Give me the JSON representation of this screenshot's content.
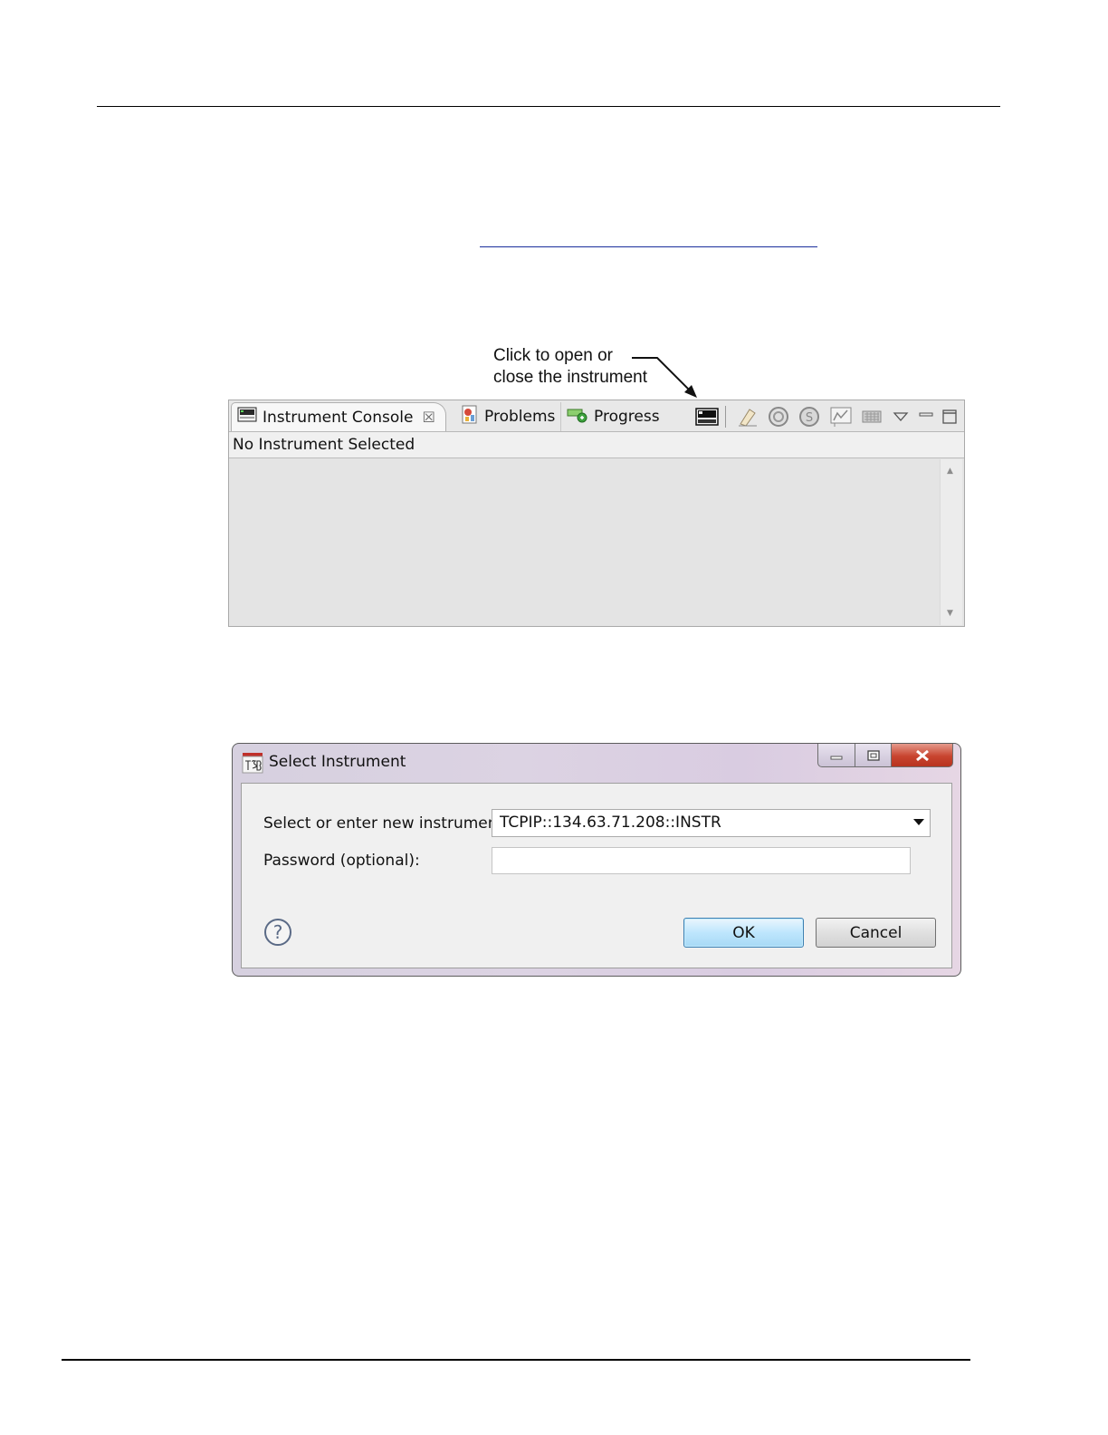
{
  "callout": {
    "line1": "Click to open or",
    "line2": "close the instrument"
  },
  "console_view": {
    "tabs": [
      {
        "label": "Instrument Console",
        "icon": "instrument-console-icon",
        "active": true
      },
      {
        "label": "Problems",
        "icon": "problems-icon",
        "active": false
      },
      {
        "label": "Progress",
        "icon": "progress-icon",
        "active": false
      }
    ],
    "toolbar_icons": [
      "instrument-connect-icon",
      "clear-console-icon",
      "abort-icon",
      "script-icon",
      "graph-icon",
      "keyboard-icon",
      "view-menu-icon",
      "minimize-icon",
      "maximize-icon"
    ],
    "status": "No Instrument Selected"
  },
  "dialog": {
    "title": "Select Instrument",
    "instrument_label": "Select or enter new instrument:",
    "instrument_value": "TCPIP::134.63.71.208::INSTR",
    "password_label": "Password (optional):",
    "password_value": "",
    "ok_label": "OK",
    "cancel_label": "Cancel"
  },
  "colors": {
    "link_underline": "#1a2e9c",
    "ok_button_border": "#3c7fb1",
    "close_button": "#c8442f"
  }
}
